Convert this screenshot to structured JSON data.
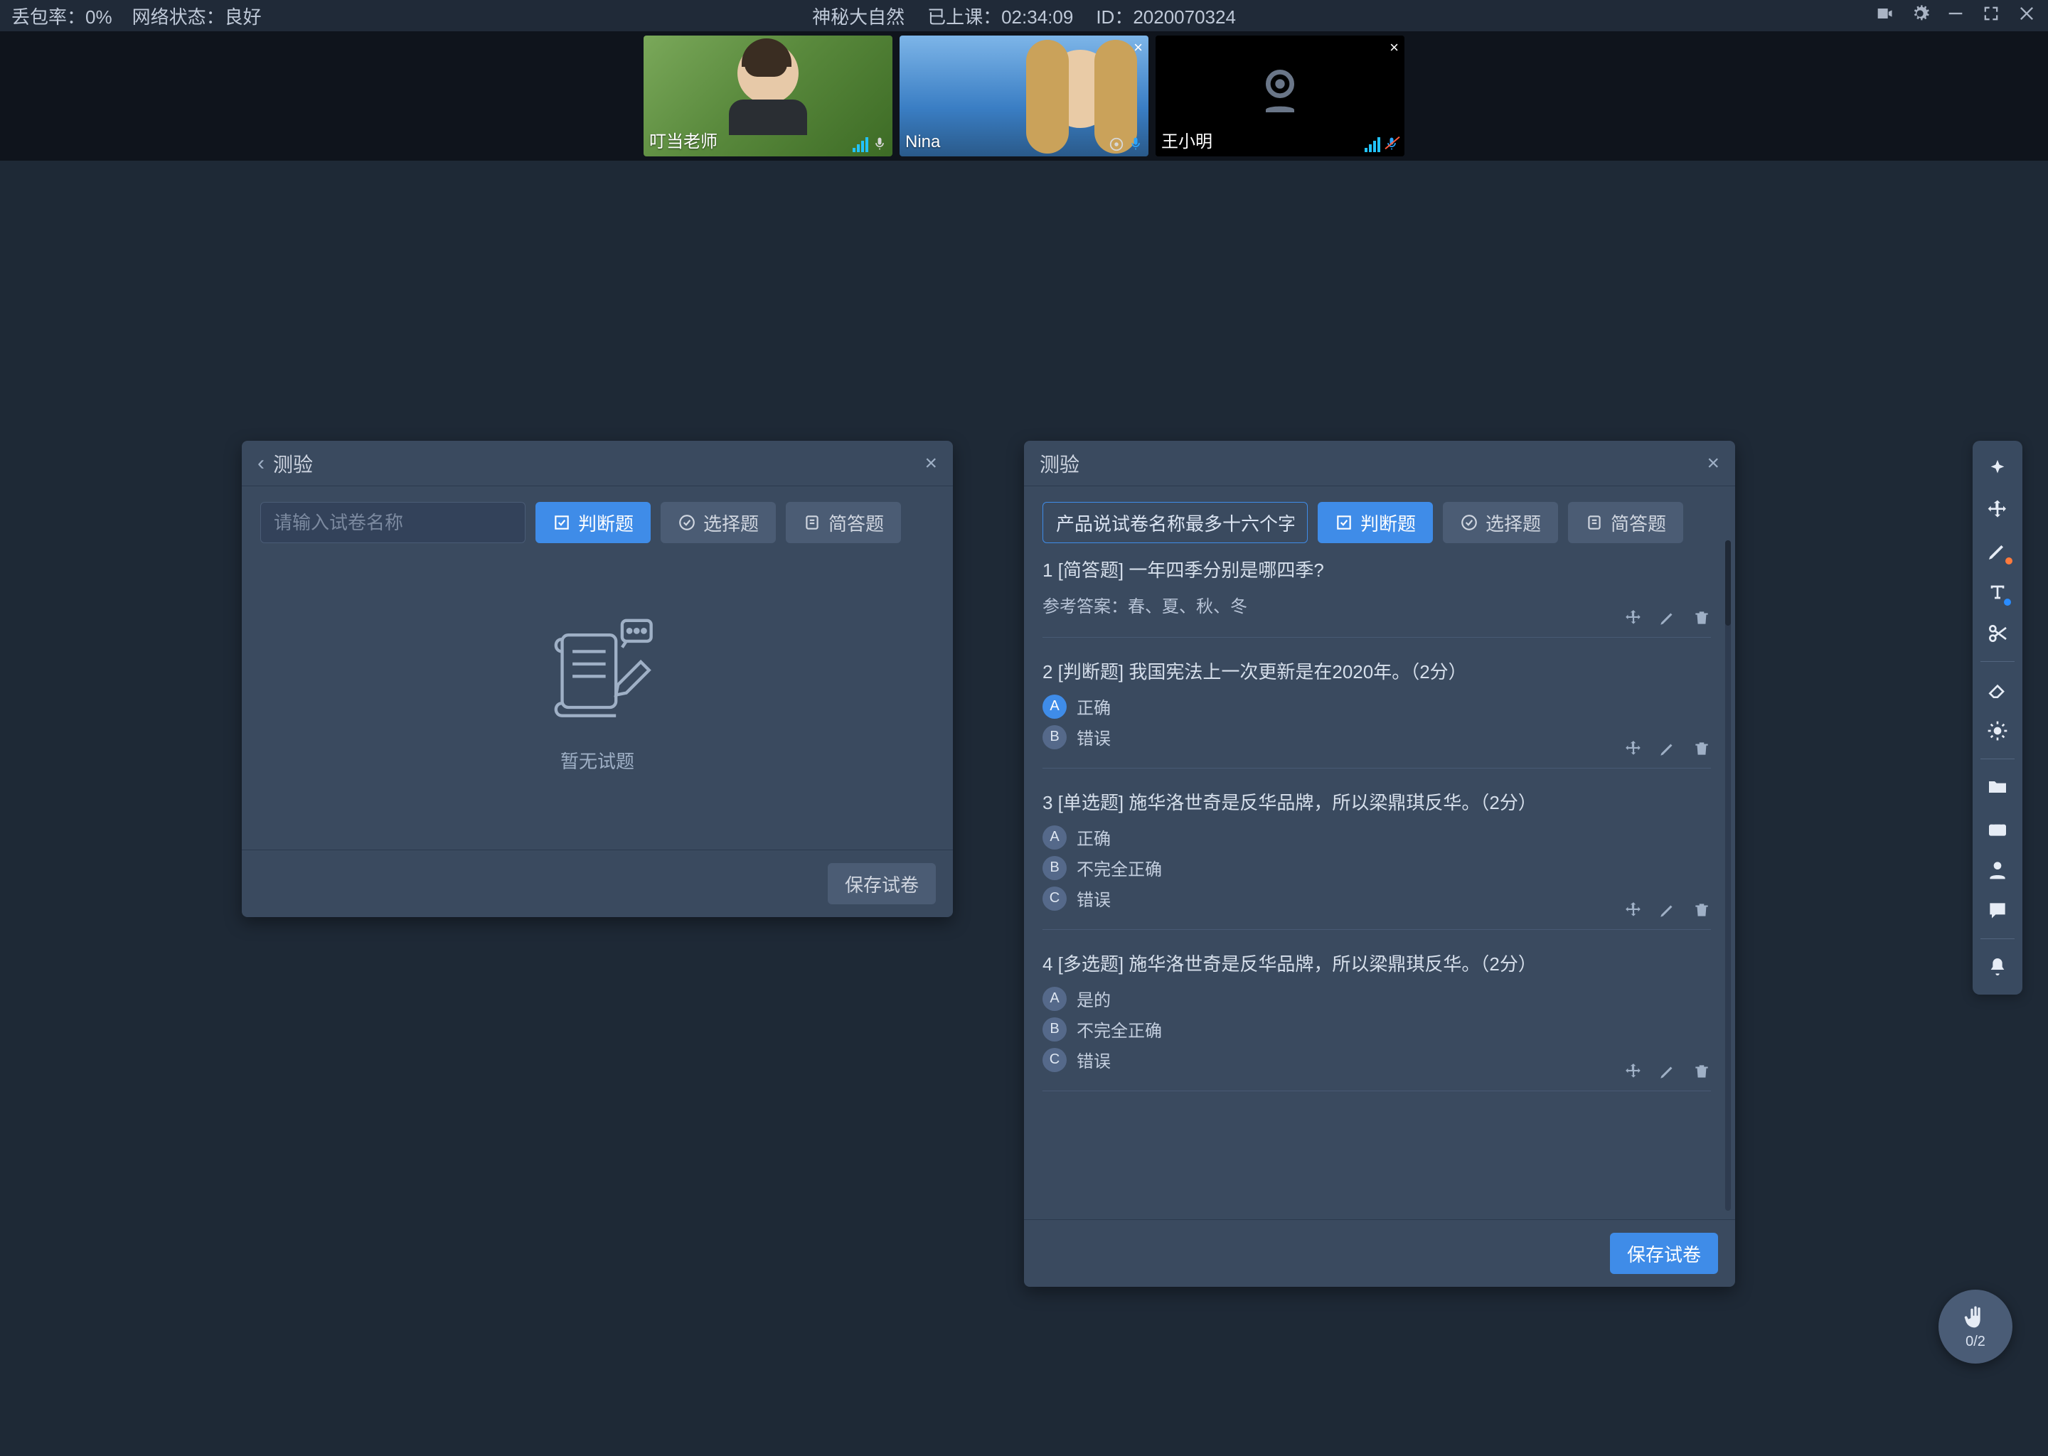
{
  "topbar": {
    "loss_label": "丢包率：",
    "loss_value": "0%",
    "net_label": "网络状态：",
    "net_value": "良好",
    "course_name": "神秘大自然",
    "elapsed_label": "已上课：",
    "elapsed_value": "02:34:09",
    "id_label": "ID：",
    "id_value": "2020070324"
  },
  "videos": [
    {
      "name": "叮当老师",
      "closable": false,
      "mic": "on",
      "camera_off": false
    },
    {
      "name": "Nina",
      "closable": true,
      "mic": "on",
      "camera_off": false
    },
    {
      "name": "王小明",
      "closable": true,
      "mic": "off",
      "camera_off": true
    }
  ],
  "panelA": {
    "title": "测验",
    "placeholder": "请输入试卷名称",
    "btn_tf": "判断题",
    "btn_mc": "选择题",
    "btn_sa": "简答题",
    "empty": "暂无试题",
    "save": "保存试卷"
  },
  "panelB": {
    "title": "测验",
    "name_value": "产品说试卷名称最多十六个字",
    "btn_tf": "判断题",
    "btn_mc": "选择题",
    "btn_sa": "简答题",
    "save": "保存试卷",
    "questions": [
      {
        "idx": "1",
        "type": "[简答题]",
        "text": "一年四季分别是哪四季?",
        "answer_label": "参考答案：",
        "answer": "春、夏、秋、冬"
      },
      {
        "idx": "2",
        "type": "[判断题]",
        "text": "我国宪法上一次更新是在2020年。（2分）",
        "options": [
          {
            "label": "A",
            "text": "正确",
            "correct": true
          },
          {
            "label": "B",
            "text": "错误",
            "correct": false
          }
        ]
      },
      {
        "idx": "3",
        "type": "[单选题]",
        "text": "施华洛世奇是反华品牌，所以梁鼎琪反华。（2分）",
        "options": [
          {
            "label": "A",
            "text": "正确",
            "correct": false
          },
          {
            "label": "B",
            "text": "不完全正确",
            "correct": false
          },
          {
            "label": "C",
            "text": "错误",
            "correct": false
          }
        ]
      },
      {
        "idx": "4",
        "type": "[多选题]",
        "text": "施华洛世奇是反华品牌，所以梁鼎琪反华。（2分）",
        "options": [
          {
            "label": "A",
            "text": "是的",
            "correct": false
          },
          {
            "label": "B",
            "text": "不完全正确",
            "correct": false
          },
          {
            "label": "C",
            "text": "错误",
            "correct": false
          }
        ]
      }
    ]
  },
  "hand": {
    "count": "0/2"
  },
  "colors": {
    "primary": "#3f8ce8",
    "panel": "#3a4a5f",
    "bg": "#1e2936"
  }
}
